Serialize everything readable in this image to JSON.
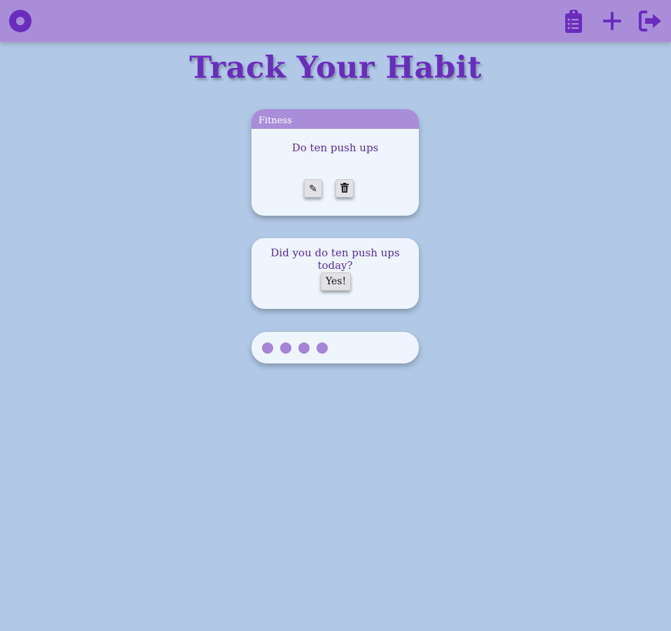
{
  "header": {
    "icons": [
      "app-logo-icon",
      "clipboard-list-icon",
      "plus-icon",
      "logout-icon"
    ],
    "accent_color": "#6a2cbd",
    "bar_color": "#a98dd9"
  },
  "page": {
    "title": "Track Your Habit"
  },
  "habit_card": {
    "category": "Fitness",
    "habit": "Do ten push ups",
    "edit_icon": "✎",
    "delete_icon": "🗑"
  },
  "question_card": {
    "question": "Did you do ten push ups today?",
    "yes_label": "Yes!"
  },
  "progress": {
    "dots_count": 4,
    "dot_color": "#a684d6"
  }
}
